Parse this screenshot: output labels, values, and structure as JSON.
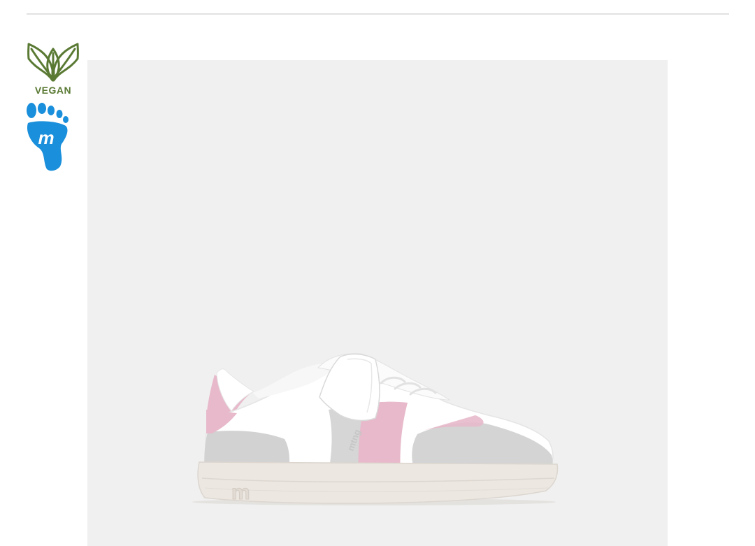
{
  "badges": {
    "vegan": {
      "label": "VEGAN",
      "icon": "leaves-icon",
      "color": "#5a7a34"
    },
    "barefoot": {
      "icon": "footprint-m-icon",
      "logo_text": "m",
      "color": "#1a8fdb"
    }
  },
  "product": {
    "image": "pink-white-sneaker-image",
    "sole_logo_text": "m",
    "side_logo_text": "mtng",
    "colors": {
      "upper": "#ffffff",
      "accent": "#e7b9ca",
      "suede": "#cfcfcf",
      "sole": "#ece7e1",
      "background": "#f0f0f0"
    }
  }
}
